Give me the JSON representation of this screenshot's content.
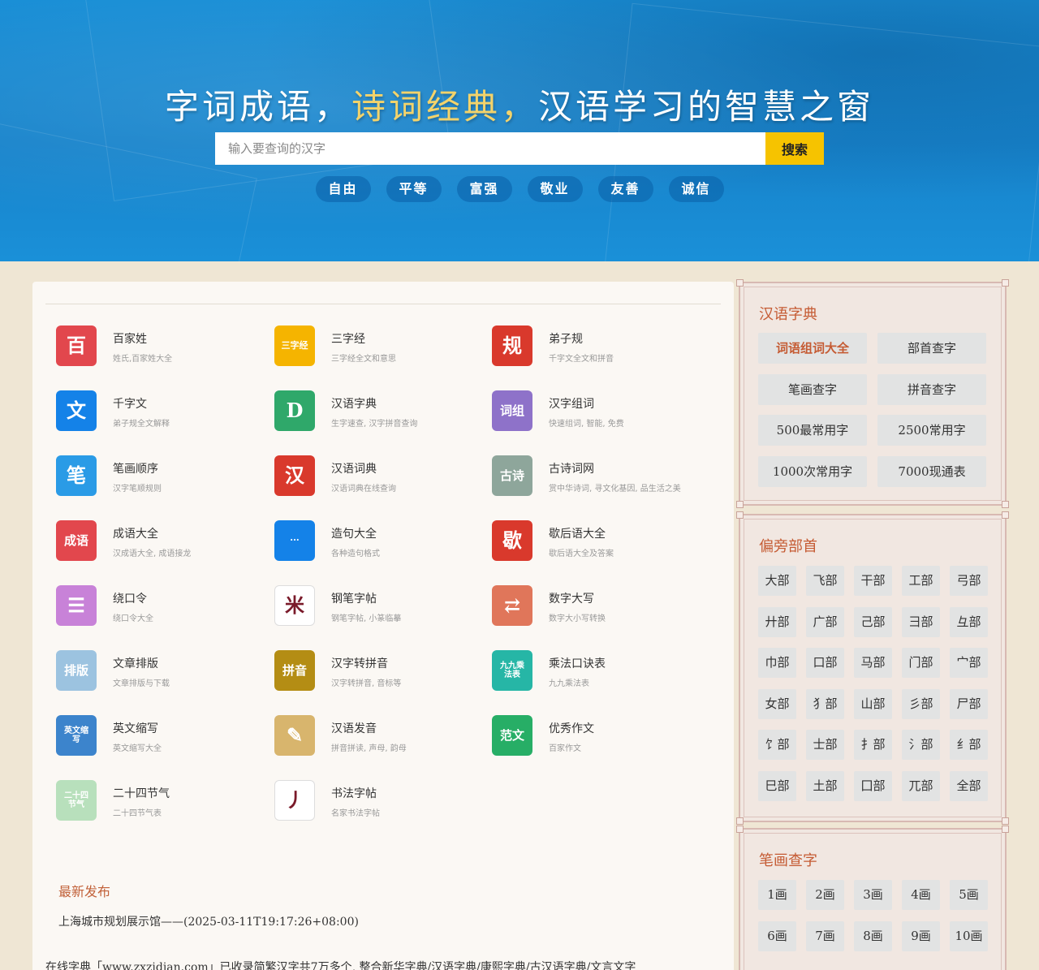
{
  "hero": {
    "title_part1": "字词成语，",
    "title_highlight": "诗词经典，",
    "title_part2": "汉语学习的智慧之窗",
    "search_placeholder": "输入要查询的汉字",
    "search_button": "搜索",
    "values": [
      "自由",
      "平等",
      "富强",
      "敬业",
      "友善",
      "诚信"
    ]
  },
  "tools": [
    {
      "title": "百家姓",
      "desc": "姓氏,百家姓大全",
      "icon": "book-icon",
      "glyph": "百",
      "color": "#e2474d"
    },
    {
      "title": "三字经",
      "desc": "三字经全文和意思",
      "icon": "scroll-icon",
      "glyph": "三字经",
      "color": "#f5b400"
    },
    {
      "title": "弟子规",
      "desc": "千字文全文和拼音",
      "icon": "gui-icon",
      "glyph": "规",
      "color": "#d9392c"
    },
    {
      "title": "千字文",
      "desc": "弟子规全文解释",
      "icon": "wen-icon",
      "glyph": "文",
      "color": "#1482e8"
    },
    {
      "title": "汉语字典",
      "desc": "生字速查, 汉字拼音查询",
      "icon": "dictionary-icon",
      "glyph": "D",
      "color": "#2fa86a"
    },
    {
      "title": "汉字组词",
      "desc": "快速组词, 智能, 免费",
      "icon": "word-book-icon",
      "glyph": "词组",
      "color": "#8e72c9"
    },
    {
      "title": "笔画顺序",
      "desc": "汉字笔顺规则",
      "icon": "brush-icon",
      "glyph": "笔",
      "color": "#2a9be6"
    },
    {
      "title": "汉语词典",
      "desc": "汉语词典在线查询",
      "icon": "han-icon",
      "glyph": "汉",
      "color": "#d9392c"
    },
    {
      "title": "古诗词网",
      "desc": "赏中华诗词, 寻文化基因, 品生活之美",
      "icon": "poem-icon",
      "glyph": "古诗",
      "color": "#8ea69b"
    },
    {
      "title": "成语大全",
      "desc": "汉成语大全, 成语接龙",
      "icon": "idiom-icon",
      "glyph": "成语",
      "color": "#e2474d"
    },
    {
      "title": "造句大全",
      "desc": "各种造句格式",
      "icon": "chat-icon",
      "glyph": "···",
      "color": "#1482e8"
    },
    {
      "title": "歇后语大全",
      "desc": "歇后语大全及答案",
      "icon": "xie-icon",
      "glyph": "歇",
      "color": "#d9392c"
    },
    {
      "title": "绕口令",
      "desc": "绕口令大全",
      "icon": "list-icon",
      "glyph": "☰",
      "color": "#c882d8"
    },
    {
      "title": "钢笔字帖",
      "desc": "钢笔字帖, 小篆临摹",
      "icon": "grid-icon",
      "glyph": "米",
      "color": "#ffffff"
    },
    {
      "title": "数字大写",
      "desc": "数字大小写转换",
      "icon": "convert-icon",
      "glyph": "⇄",
      "color": "#e0765a"
    },
    {
      "title": "文章排版",
      "desc": "文章排版与下载",
      "icon": "layout-icon",
      "glyph": "排版",
      "color": "#9cc3e0"
    },
    {
      "title": "汉字转拼音",
      "desc": "汉字转拼音, 音标等",
      "icon": "pinyin-icon",
      "glyph": "拼音",
      "color": "#b48d14"
    },
    {
      "title": "乘法口诀表",
      "desc": "九九乘法表",
      "icon": "multiplication-icon",
      "glyph": "九九乘法表",
      "color": "#26b6a6"
    },
    {
      "title": "英文缩写",
      "desc": "英文缩写大全",
      "icon": "abbr-icon",
      "glyph": "英文缩写",
      "color": "#3c84cc"
    },
    {
      "title": "汉语发音",
      "desc": "拼音拼读, 声母, 韵母",
      "icon": "pen-icon",
      "glyph": "✎",
      "color": "#d8b56d"
    },
    {
      "title": "优秀作文",
      "desc": "百家作文",
      "icon": "essay-icon",
      "glyph": "范文",
      "color": "#27ae66"
    },
    {
      "title": "二十四节气",
      "desc": "二十四节气表",
      "icon": "solar-term-icon",
      "glyph": "二十四节气",
      "color": "#b8e0bc"
    },
    {
      "title": "书法字帖",
      "desc": "名家书法字帖",
      "icon": "calligraphy-icon",
      "glyph": "丿",
      "color": "#ffffff"
    }
  ],
  "latest": {
    "heading": "最新发布",
    "item": "上海城市规划展示馆——(2025-03-11T19:17:26+08:00)"
  },
  "footer_text": "在线字典「www.zxzidian.com」已收录简繁汉字共7万多个, 整合新华字典/汉语字典/康熙字典/古汉语字典/文言文字",
  "sidebar": {
    "dict": {
      "title": "汉语字典",
      "buttons": [
        "词语组词大全",
        "部首查字",
        "笔画查字",
        "拼音查字",
        "500最常用字",
        "2500常用字",
        "1000次常用字",
        "7000现通表"
      ]
    },
    "radicals": {
      "title": "偏旁部首",
      "items": [
        "大部",
        "飞部",
        "干部",
        "工部",
        "弓部",
        "廾部",
        "广部",
        "己部",
        "彐部",
        "彑部",
        "巾部",
        "口部",
        "马部",
        "门部",
        "宀部",
        "女部",
        "犭部",
        "山部",
        "彡部",
        "尸部",
        "饣部",
        "士部",
        "扌部",
        "氵部",
        "纟部",
        "巳部",
        "土部",
        "囗部",
        "兀部",
        "全部"
      ]
    },
    "strokes": {
      "title": "笔画查字",
      "items": [
        "1画",
        "2画",
        "3画",
        "4画",
        "5画",
        "6画",
        "7画",
        "8画",
        "9画",
        "10画"
      ]
    }
  },
  "colors": {
    "hero_blue": "#1783cb",
    "accent_yellow": "#f6c300",
    "title_highlight": "#f3d36b",
    "sidebar_title": "#c55b33"
  }
}
